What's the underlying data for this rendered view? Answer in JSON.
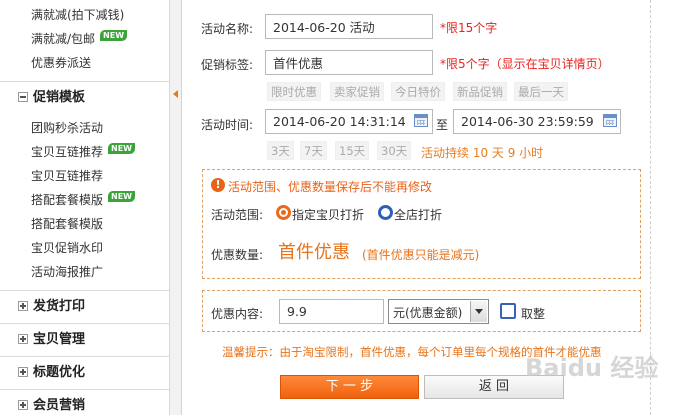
{
  "sidebar": {
    "items_top": [
      {
        "label": "满就减(拍下减钱)",
        "new": false
      },
      {
        "label": "满就减/包邮",
        "new": true
      },
      {
        "label": "优惠券派送",
        "new": false
      }
    ],
    "group_promo": "促销模板",
    "items_promo": [
      {
        "label": "团购秒杀活动",
        "new": false
      },
      {
        "label": "宝贝互链推荐",
        "new": true
      },
      {
        "label": "宝贝互链推荐",
        "new": false
      },
      {
        "label": "搭配套餐模版",
        "new": true
      },
      {
        "label": "搭配套餐模版",
        "new": false
      },
      {
        "label": "宝贝促销水印",
        "new": false
      },
      {
        "label": "活动海报推广",
        "new": false
      }
    ],
    "groups_bottom": [
      "发货打印",
      "宝贝管理",
      "标题优化",
      "会员营销"
    ],
    "new_badge": "NEW"
  },
  "form": {
    "name_label": "活动名称:",
    "name_value": "2014-06-20 活动",
    "name_hint": "*限15个字",
    "tag_label": "促销标签:",
    "tag_value": "首件优惠",
    "tag_hint": "*限5个字（显示在宝贝详情页）",
    "tag_presets": [
      "限时优惠",
      "卖家促销",
      "今日特价",
      "新品促销",
      "最后一天"
    ],
    "time_label": "活动时间:",
    "start_time": "2014-06-20 14:31:14",
    "time_sep": "至",
    "end_time": "2014-06-30 23:59:59",
    "duration_presets": [
      "3天",
      "7天",
      "15天",
      "30天"
    ],
    "duration_text": "活动持续 10 天 9 小时"
  },
  "scope_box": {
    "warning": "活动范围、优惠数量保存后不能再修改",
    "scope_label": "活动范围:",
    "option_specific": "指定宝贝打折",
    "option_all": "全店打折",
    "qty_label": "优惠数量:",
    "qty_value": "首件优惠",
    "qty_note": "(首件优惠只能是减元)"
  },
  "discount_box": {
    "label": "优惠内容:",
    "value": "9.9",
    "unit_option": "元(优惠金额)",
    "round_label": "取整"
  },
  "tip": "温馨提示：由于淘宝限制，首件优惠，每个订单里每个规格的首件才能优惠",
  "buttons": {
    "next": "下 一 步",
    "back": "返 回"
  },
  "watermark": "Baidu 经验",
  "colors": {
    "accent_orange": "#f0620c",
    "hint_red": "#e8231f",
    "radio_blue": "#2d5fb5",
    "badge_green": "#3aa33a"
  }
}
